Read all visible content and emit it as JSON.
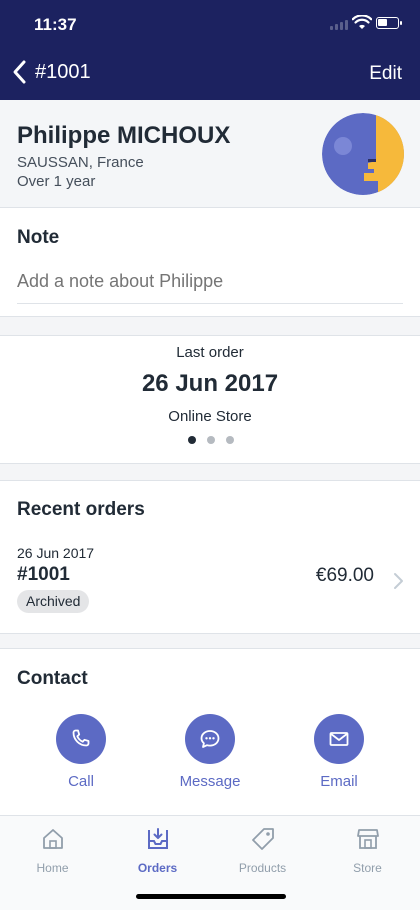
{
  "status_bar": {
    "time": "11:37"
  },
  "nav": {
    "back_title": "#1001",
    "edit_label": "Edit"
  },
  "customer": {
    "name": "Philippe MICHOUX",
    "location": "SAUSSAN, France",
    "tenure": "Over 1 year"
  },
  "note": {
    "title": "Note",
    "placeholder": "Add a note about Philippe"
  },
  "last_order": {
    "label": "Last order",
    "date": "26 Jun 2017",
    "channel": "Online Store",
    "page_count": 3,
    "active_page": 1
  },
  "recent_orders": {
    "title": "Recent orders",
    "items": [
      {
        "date": "26 Jun 2017",
        "number": "#1001",
        "total": "€69.00",
        "status": "Archived"
      }
    ]
  },
  "contact": {
    "title": "Contact",
    "call_label": "Call",
    "message_label": "Message",
    "email_label": "Email"
  },
  "tabs": [
    {
      "label": "Home",
      "icon": "home-icon",
      "active": false
    },
    {
      "label": "Orders",
      "icon": "orders-icon",
      "active": true
    },
    {
      "label": "Products",
      "icon": "tag-icon",
      "active": false
    },
    {
      "label": "Store",
      "icon": "store-icon",
      "active": false
    }
  ],
  "colors": {
    "nav_background": "#1c2260",
    "accent": "#5c6ac4",
    "avatar_background": "#5c6ac4",
    "avatar_face": "#f6b93b"
  }
}
